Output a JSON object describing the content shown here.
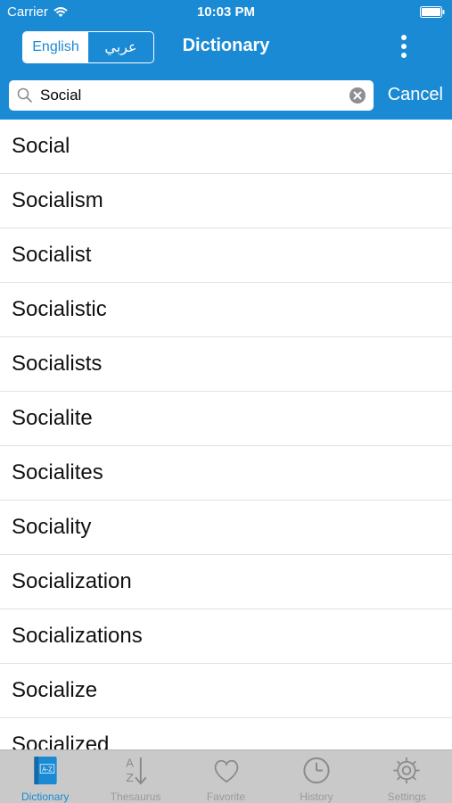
{
  "status_bar": {
    "carrier": "Carrier",
    "time": "10:03 PM"
  },
  "nav": {
    "title": "Dictionary",
    "languages": [
      "English",
      "عربي"
    ],
    "selected_language": "English"
  },
  "search": {
    "value": "Social",
    "cancel_label": "Cancel"
  },
  "results": [
    "Social",
    "Socialism",
    "Socialist",
    "Socialistic",
    "Socialists",
    "Socialite",
    "Socialites",
    "Sociality",
    "Socialization",
    "Socializations",
    "Socialize",
    "Socialized"
  ],
  "tabs": [
    {
      "label": "Dictionary",
      "icon": "dictionary-book-icon",
      "active": true
    },
    {
      "label": "Thesaurus",
      "icon": "az-sort-icon",
      "active": false
    },
    {
      "label": "Favorite",
      "icon": "heart-icon",
      "active": false
    },
    {
      "label": "History",
      "icon": "clock-icon",
      "active": false
    },
    {
      "label": "Settings",
      "icon": "gear-icon",
      "active": false
    }
  ],
  "colors": {
    "primary": "#1a8ad4",
    "tab_bar": "#c9c9c9",
    "tab_inactive": "#9a9a9a"
  }
}
